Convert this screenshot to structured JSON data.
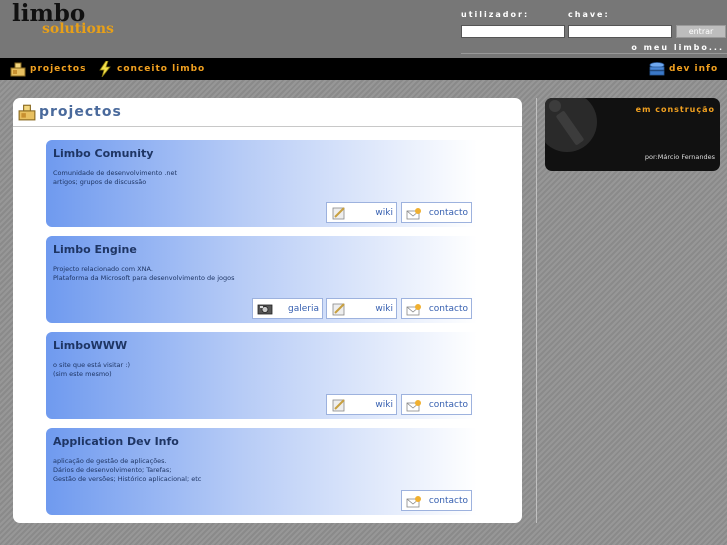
{
  "header": {
    "logo_line1": "limbo",
    "logo_line2": "solutions",
    "user_label": "utilizador:",
    "password_label": "chave:",
    "login_button": "entrar",
    "my_limbo_link": "o meu limbo..."
  },
  "nav": {
    "items": [
      {
        "label": "projectos",
        "icon": "projects-icon"
      },
      {
        "label": "conceito limbo",
        "icon": "lightning-icon"
      },
      {
        "label": "dev info",
        "icon": "stack-icon"
      }
    ]
  },
  "panel": {
    "title": "projectos",
    "projects": [
      {
        "title": "Limbo Comunity",
        "desc": [
          "Comunidade de desenvolvimento .net",
          "artigos; grupos de discussão"
        ],
        "buttons": [
          "wiki",
          "contacto"
        ]
      },
      {
        "title": "Limbo Engine",
        "desc": [
          "Projecto relacionado com XNA.",
          "Plataforma da Microsoft para desenvolvimento de jogos"
        ],
        "buttons": [
          "galeria",
          "wiki",
          "contacto"
        ]
      },
      {
        "title": "LimboWWW",
        "desc": [
          "o site que está visitar :)",
          "(sim este mesmo)"
        ],
        "buttons": [
          "wiki",
          "contacto"
        ]
      },
      {
        "title": "Application Dev Info",
        "desc": [
          "aplicação de gestão de aplicações.",
          "Dários de desenvolvimento; Tarefas;",
          "Gestão de versões; Histórico aplicacional; etc"
        ],
        "buttons": [
          "contacto"
        ]
      }
    ]
  },
  "side": {
    "title": "em construção",
    "author": "por:Márcio Fernandes"
  },
  "colors": {
    "accent_orange": "#f0a020",
    "card_title": "#1e3564",
    "button_text": "#3760b0"
  }
}
